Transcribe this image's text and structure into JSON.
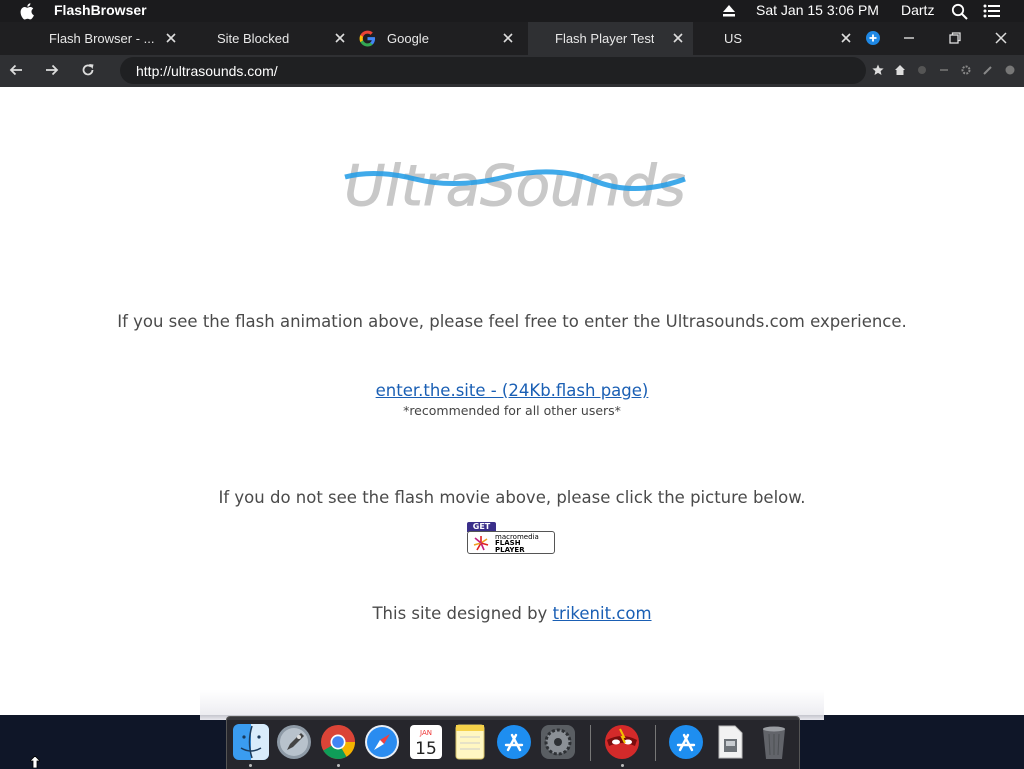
{
  "menubar": {
    "app_name": "FlashBrowser",
    "clock": "Sat Jan 15  3:06 PM",
    "user": "Dartz"
  },
  "tabs": [
    {
      "label": "Flash Browser - ...",
      "active": false
    },
    {
      "label": "Site Blocked",
      "active": false
    },
    {
      "label": "Google",
      "active": false
    },
    {
      "label": "Flash Player Test",
      "active": true
    },
    {
      "label": "US",
      "active": false
    }
  ],
  "navbar": {
    "url": "http://ultrasounds.com/"
  },
  "page": {
    "intro": "If you see the flash animation above, please feel free to enter the Ultrasounds.com experience.",
    "enter_link": "enter.the.site - (24Kb.flash page)",
    "recommended": "*recommended for all other users*",
    "no_see": "If you do not see the flash movie above, please click the picture below.",
    "credit_prefix": "This site designed by",
    "credit_link": "trikenit.com",
    "logo_text": "UltraSounds",
    "flash_badge": {
      "get": "GET",
      "brand": "macromedia",
      "product_line1": "FLASH",
      "product_line2": "PLAYER"
    }
  },
  "dock": {
    "calendar_month": "JAN",
    "calendar_day": "15",
    "items": [
      "finder-icon",
      "launchpad-icon",
      "chrome-icon",
      "safari-icon",
      "calendar-icon",
      "notes-icon",
      "app-store-icon",
      "system-preferences-icon",
      "flashbrowser-icon",
      "app-store-icon",
      "finder-disk-icon",
      "trash-icon"
    ]
  },
  "colors": {
    "link": "#1a5fb4",
    "logo_blue": "#1f9be6",
    "logo_gray": "#c8c8c8",
    "menubar": "#1b1b1d",
    "tabstrip": "#1f1f21",
    "active_tab": "#2f3033"
  }
}
